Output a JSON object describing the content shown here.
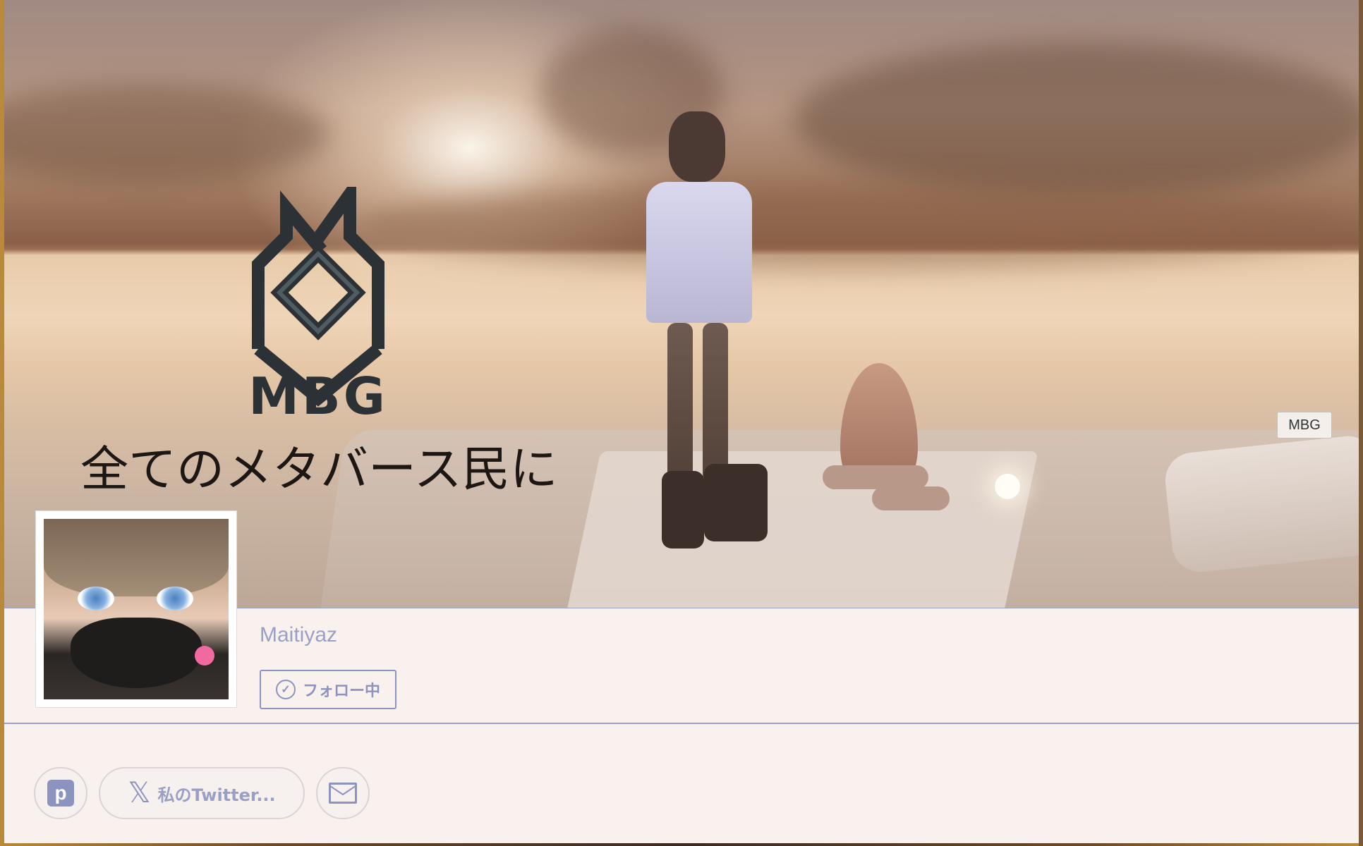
{
  "banner": {
    "logo_text": "MBG",
    "tagline": "全てのメタバース民に",
    "badge": "MBG"
  },
  "profile": {
    "username": "Maitiyaz",
    "follow_label": "フォロー中"
  },
  "links": {
    "pixiv_icon_letter": "p",
    "twitter_label": "私のTwitter...",
    "x_glyph": "𝕏"
  },
  "colors": {
    "accent": "#8d93bf",
    "background": "#f8f1ee"
  },
  "icons": [
    "check-circle-icon",
    "pixiv-icon",
    "x-icon",
    "mail-icon"
  ]
}
